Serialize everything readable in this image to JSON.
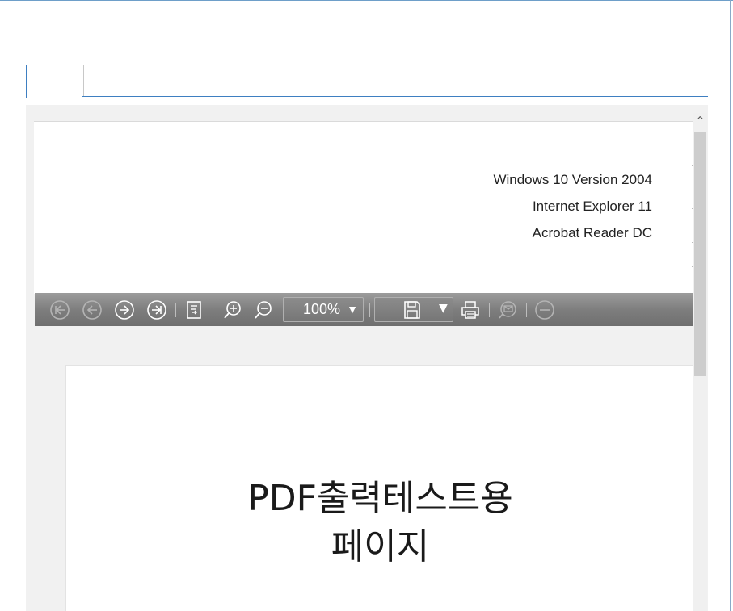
{
  "tabs": [
    {
      "label": "",
      "active": true
    },
    {
      "label": "",
      "active": false
    }
  ],
  "header": {
    "lines": [
      "Windows 10 Version 2004",
      "Internet Explorer 11",
      "Acrobat Reader DC"
    ]
  },
  "toolbar": {
    "zoom": "100%",
    "zoom_arrow": "▼",
    "save_arrow": "▼",
    "icons": [
      "first-page-icon",
      "previous-page-icon",
      "next-page-icon",
      "last-page-icon",
      "go-to-page-icon",
      "zoom-in-icon",
      "zoom-out-icon",
      "save-icon",
      "print-icon",
      "email-icon",
      "collapse-icon"
    ]
  },
  "scrollbar": {
    "up_arrow": "^"
  },
  "pdf": {
    "line1": "PDF출력테스트용",
    "line2": "페이지"
  },
  "colors": {
    "accent": "#3e7fc1",
    "toolbar": "#7e7e7e"
  }
}
